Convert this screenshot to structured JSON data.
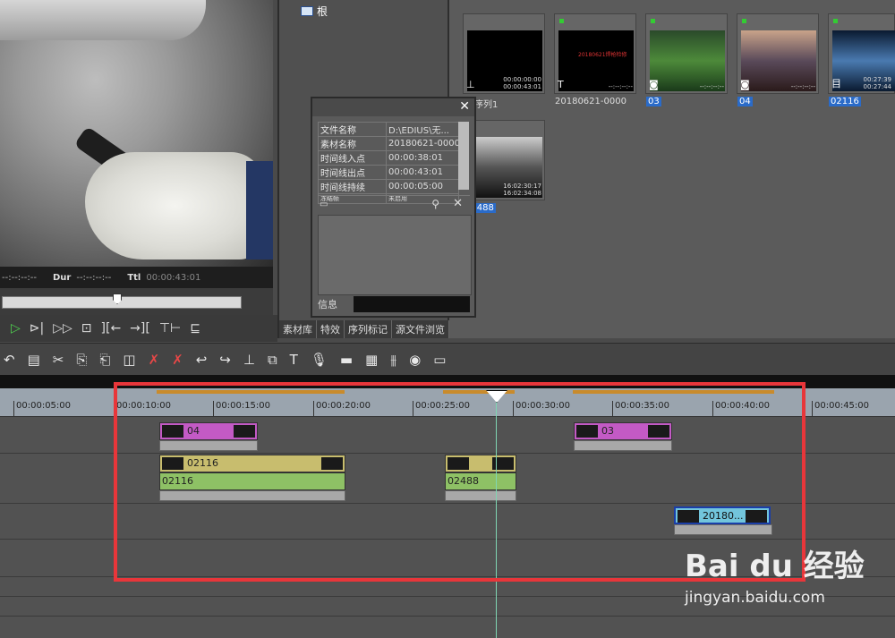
{
  "player": {
    "tc_in": "--:--:--:--",
    "dur_label": "Dur",
    "dur_value": "--:--:--:--",
    "ttl_label": "Ttl",
    "ttl_value": "00:00:43:01"
  },
  "bin": {
    "root": "根",
    "tabs": [
      "素材库",
      "特效",
      "序列标记",
      "源文件浏览"
    ],
    "clips": [
      {
        "name": "序列1",
        "tc": [
          "00:00:00:00",
          "00:00:43:01"
        ],
        "icon": "sequence-icon",
        "selected": false
      },
      {
        "name": "20180621-0000",
        "tc": [
          "--:--:--:--"
        ],
        "icon": "title-icon",
        "selected": false,
        "label": "20180621焊枪检修"
      },
      {
        "name": "03",
        "tc": [
          "--:--:--:--"
        ],
        "icon": "camera-icon",
        "selected": true
      },
      {
        "name": "04",
        "tc": [
          "--:--:--:--"
        ],
        "icon": "camera-icon",
        "selected": true
      },
      {
        "name": "02116",
        "tc": [
          "00:27:39",
          "00:27:44"
        ],
        "icon": "film-icon",
        "selected": true
      },
      {
        "name": "02488",
        "tc": [
          "16:02:30:17",
          "16:02:34:08"
        ],
        "icon": "film-icon",
        "selected": true
      }
    ]
  },
  "info": {
    "rows": [
      [
        "文件名称",
        "D:\\EDIUS\\无..."
      ],
      [
        "素材名称",
        "20180621-0000"
      ],
      [
        "时间线入点",
        "00:00:38:01"
      ],
      [
        "时间线出点",
        "00:00:43:01"
      ],
      [
        "时间线持续",
        "00:00:05:00"
      ],
      [
        "冻结帧",
        "未启用"
      ]
    ],
    "footer_label": "信息"
  },
  "ruler": {
    "labels": [
      "00:00:05:00",
      "00:00:10:00",
      "00:00:15:00",
      "00:00:20:00",
      "00:00:25:00",
      "00:00:30:00",
      "00:00:35:00",
      "00:00:40:00",
      "00:00:45:00"
    ]
  },
  "timeline": {
    "clips": [
      {
        "label": "04",
        "style": "magenta"
      },
      {
        "label": "03",
        "style": "magenta"
      },
      {
        "label": "02116",
        "style": "khaki"
      },
      {
        "label": "02116",
        "style": "green"
      },
      {
        "label": "02488",
        "style": "green"
      },
      {
        "label": "20180...",
        "style": "cyan"
      }
    ]
  },
  "watermark": {
    "brand": "Bai du 经验",
    "url": "jingyan.baidu.com"
  },
  "colors": {
    "play": "#4fd14f",
    "highlight_box": "#e8363a",
    "cursor": "#7fd6b3"
  }
}
